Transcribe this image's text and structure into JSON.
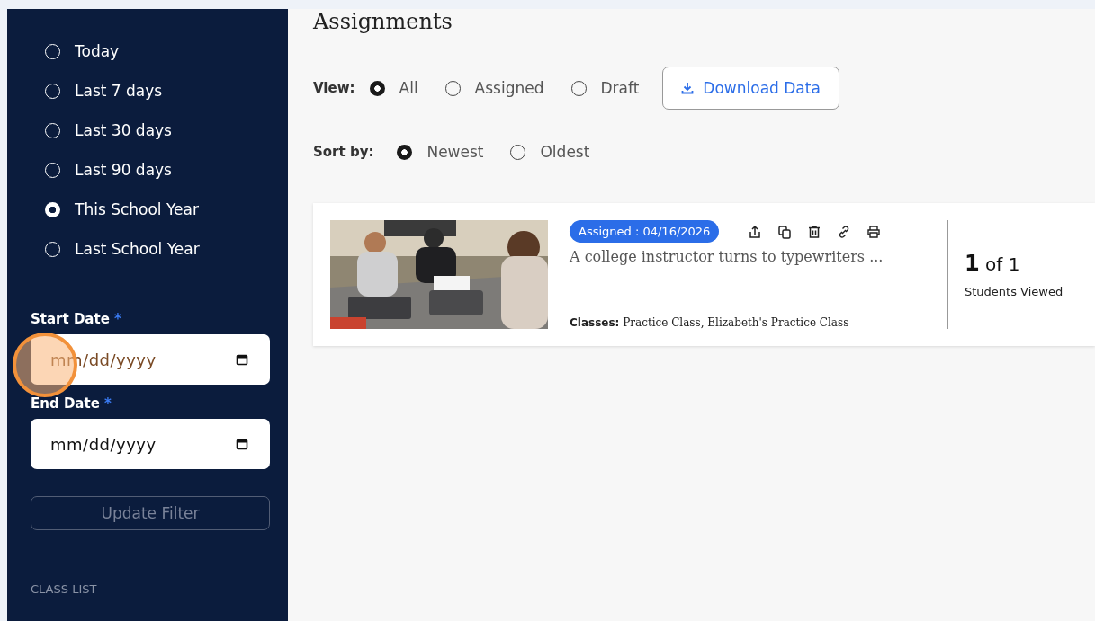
{
  "page_title": "Assignments",
  "sidebar": {
    "date_ranges": [
      {
        "label": "Today",
        "selected": false
      },
      {
        "label": "Last 7 days",
        "selected": false
      },
      {
        "label": "Last 30 days",
        "selected": false
      },
      {
        "label": "Last 90 days",
        "selected": false
      },
      {
        "label": "This School Year",
        "selected": true
      },
      {
        "label": "Last School Year",
        "selected": false
      }
    ],
    "fields": [
      {
        "label": "Start Date",
        "required_mark": "*",
        "placeholder": "mm/dd/yyyy",
        "highlighted": true
      },
      {
        "label": "End Date",
        "required_mark": "*",
        "placeholder": "mm/dd/yyyy",
        "highlighted": false
      }
    ],
    "update_button": {
      "label": "Update Filter",
      "disabled": true
    },
    "section_heading": "CLASS LIST"
  },
  "view_filter": {
    "label": "View:",
    "options": [
      {
        "label": "All",
        "selected": true
      },
      {
        "label": "Assigned",
        "selected": false
      },
      {
        "label": "Draft",
        "selected": false
      }
    ],
    "download_button": "Download Data"
  },
  "sort_filter": {
    "label": "Sort by:",
    "options": [
      {
        "label": "Newest",
        "selected": true
      },
      {
        "label": "Oldest",
        "selected": false
      }
    ]
  },
  "assignments": [
    {
      "badge": "Assigned : 04/16/2026",
      "title": "A college instructor turns to typewriters ...",
      "classes_label": "Classes:",
      "classes": "Practice Class, Elizabeth's Practice Class",
      "viewed_count": "1",
      "viewed_of": "of 1",
      "viewed_label": "Students Viewed"
    }
  ]
}
